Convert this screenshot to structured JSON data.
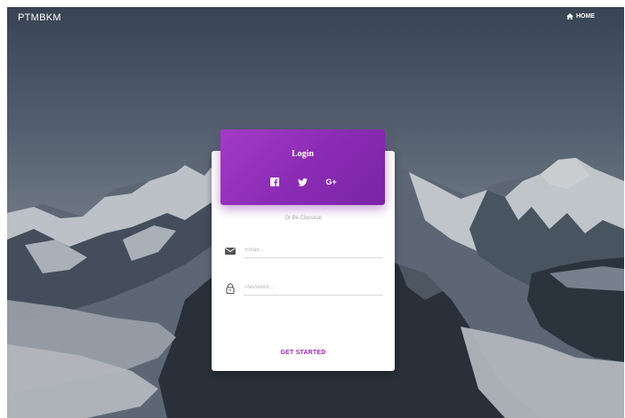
{
  "navbar": {
    "brand": "PTMBKM",
    "home_label": "HOME"
  },
  "login_card": {
    "title": "Login",
    "social": [
      {
        "icon": "facebook-icon"
      },
      {
        "icon": "twitter-icon"
      },
      {
        "label": "G+",
        "icon": "google-plus-icon"
      }
    ],
    "divider_text": "Or Be Classical",
    "email": {
      "placeholder": "Email...",
      "value": ""
    },
    "password": {
      "placeholder": "Password...",
      "value": ""
    },
    "submit_label": "GET STARTED"
  },
  "colors": {
    "accent": "#9c27b0",
    "header_gradient_start": "#a23bc6",
    "header_gradient_end": "#7a24a6"
  }
}
